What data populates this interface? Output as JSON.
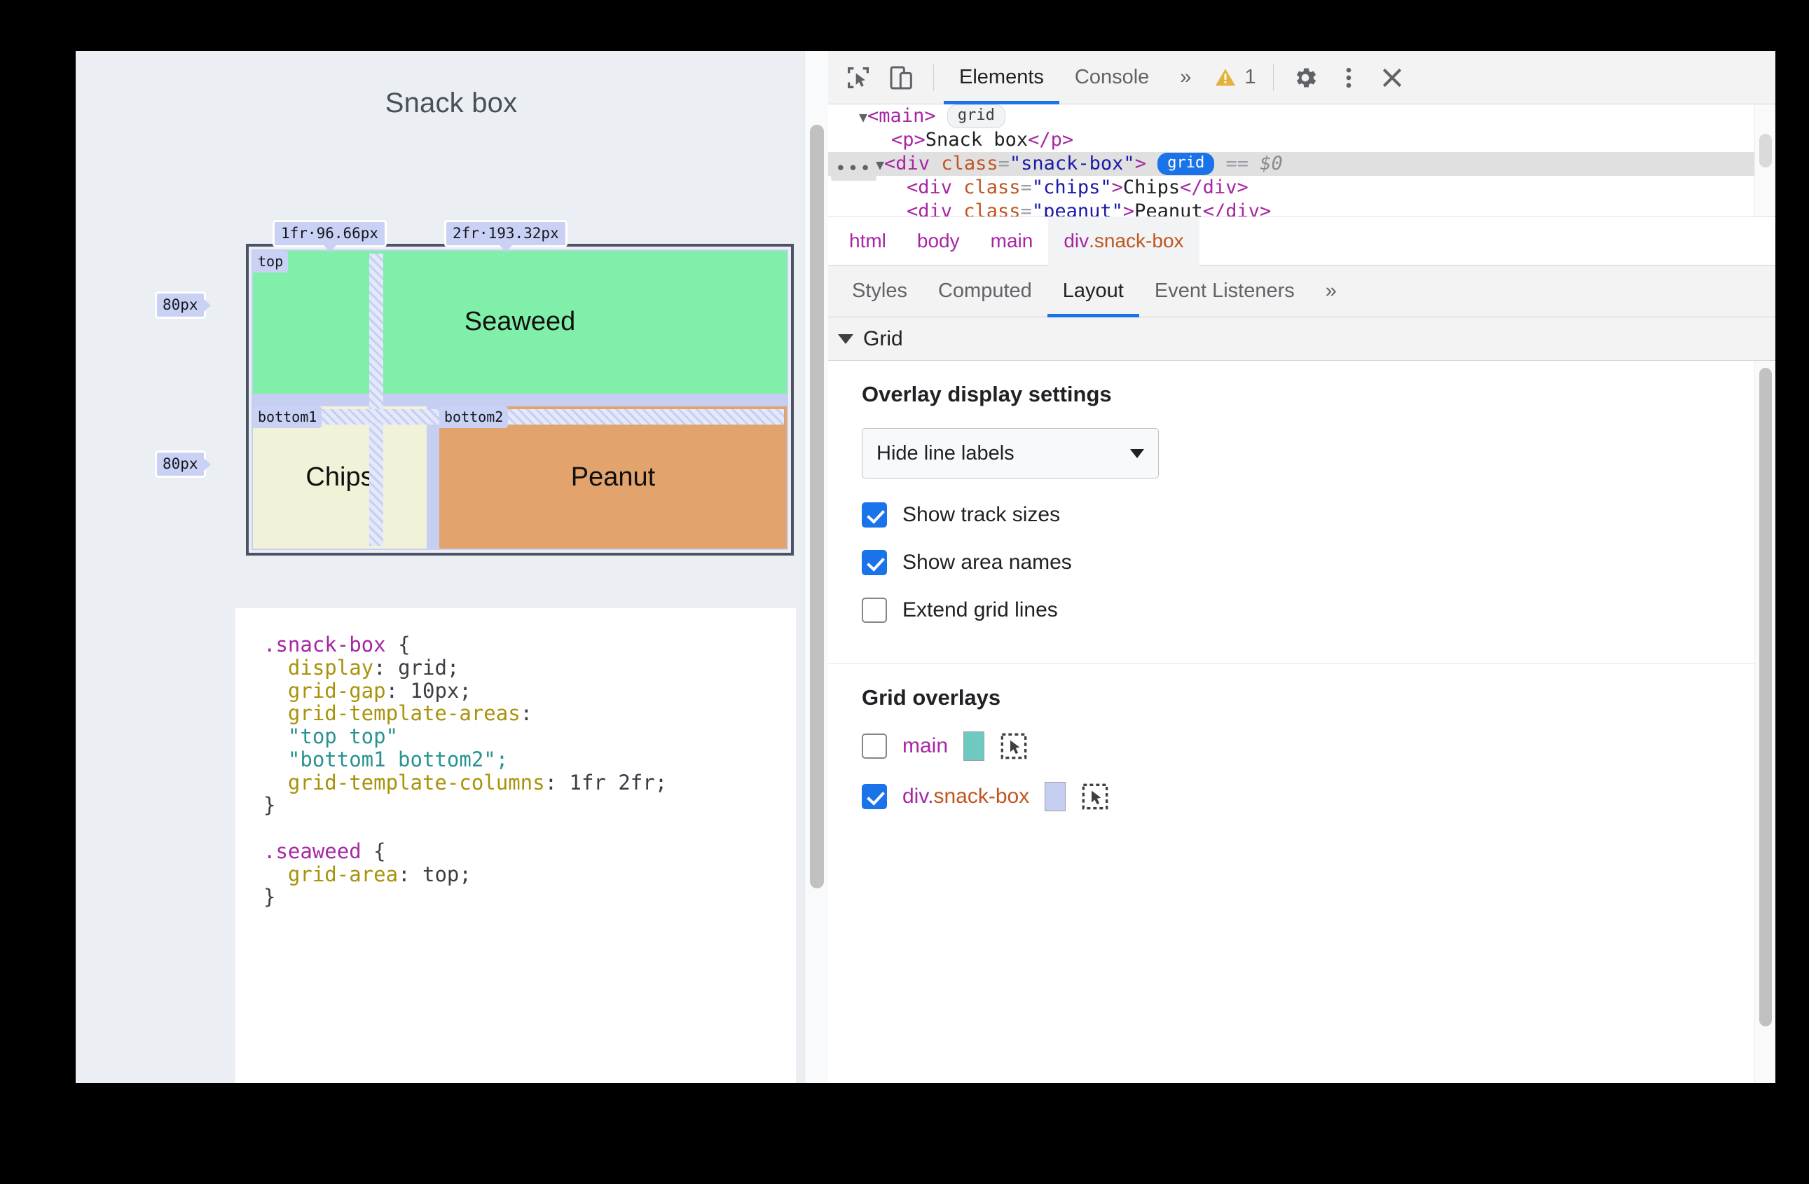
{
  "page": {
    "title": "Snack box",
    "grid": {
      "column_labels": [
        "1fr·96.66px",
        "2fr·193.32px"
      ],
      "row_labels": [
        "80px",
        "80px"
      ],
      "areas": [
        {
          "area_name": "top",
          "text": "Seaweed",
          "color": "#7FEFA9"
        },
        {
          "area_name": "bottom1",
          "text": "Chips",
          "color": "#F2F2D9"
        },
        {
          "area_name": "bottom2",
          "text": "Peanut",
          "color": "#E3A36C"
        }
      ]
    },
    "code": {
      "rule1_selector": ".snack-box",
      "rule1_open": " {",
      "lines": [
        {
          "prop": "display",
          "value": "grid;"
        },
        {
          "prop": "grid-gap",
          "value": "10px;"
        }
      ],
      "areas_prop": "grid-template-areas",
      "areas_line1": "\"top top\"",
      "areas_line2": "\"bottom1 bottom2\";",
      "columns_prop": "grid-template-columns",
      "columns_value": "1fr 2fr;",
      "close": "}",
      "rule2_selector": ".seaweed",
      "rule2_prop": "grid-area",
      "rule2_value": "top;"
    }
  },
  "devtools": {
    "toolbar": {
      "inspect_icon": "inspect-element-icon",
      "device_icon": "device-toolbar-icon",
      "tabs": [
        {
          "label": "Elements",
          "active": true
        },
        {
          "label": "Console",
          "active": false
        }
      ],
      "more_tabs": "»",
      "warning_count": "1",
      "settings_icon": "gear-icon",
      "more_options_icon": "kebab-menu-icon",
      "close_icon": "close-icon"
    },
    "dom_tree": {
      "rows": [
        {
          "indent": 1,
          "triangle": "▼",
          "tag_open": "<main>",
          "badge": "grid",
          "badge_style": "grey",
          "selected": false
        },
        {
          "indent": 2,
          "triangle": "",
          "tag_open": "<p>",
          "text": "Snack box",
          "tag_close": "</p>",
          "selected": false
        },
        {
          "indent": 1,
          "triangle": "▼",
          "tag_open": "<div class=\"snack-box\">",
          "badge": "grid",
          "badge_style": "blue",
          "eq": "==",
          "dollar": "$0",
          "selected": true,
          "ellipsis": "•••"
        },
        {
          "indent": 3,
          "triangle": "",
          "tag_open": "<div class=\"chips\">",
          "text": "Chips",
          "tag_close": "</div>",
          "selected": false
        },
        {
          "indent": 3,
          "triangle": "",
          "tag_open": "<div class=\"peanut\">",
          "text": "Peanut",
          "tag_close": "</div>",
          "selected": false
        }
      ]
    },
    "breadcrumb": [
      {
        "label": "html",
        "active": false
      },
      {
        "label": "body",
        "active": false
      },
      {
        "label": "main",
        "active": false
      },
      {
        "label": "div.snack-box",
        "active": true
      }
    ],
    "sub_tabs": [
      {
        "label": "Styles",
        "active": false
      },
      {
        "label": "Computed",
        "active": false
      },
      {
        "label": "Layout",
        "active": true
      },
      {
        "label": "Event Listeners",
        "active": false
      },
      {
        "label": "»",
        "active": false
      }
    ],
    "layout": {
      "section_title": "Grid",
      "overlay_settings_title": "Overlay display settings",
      "line_labels_select": "Hide line labels",
      "checkboxes": [
        {
          "label": "Show track sizes",
          "checked": true
        },
        {
          "label": "Show area names",
          "checked": true
        },
        {
          "label": "Extend grid lines",
          "checked": false
        }
      ],
      "overlays_title": "Grid overlays",
      "overlays": [
        {
          "name": "main",
          "class_part": "",
          "checked": false,
          "color": "#6EC9C1"
        },
        {
          "name": "div.",
          "class_part": "snack-box",
          "checked": true,
          "color": "#C6CFF2"
        }
      ]
    }
  },
  "colors": {
    "accent": "#1A73E8",
    "page_bg": "#EBEEF3",
    "grid_overlay_blue": "#C6CFF2",
    "warning_yellow": "#E3B23C"
  }
}
